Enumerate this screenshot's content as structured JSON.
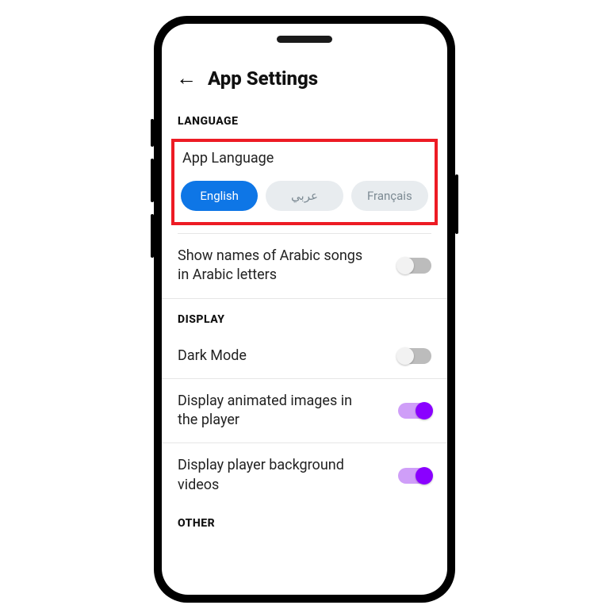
{
  "header": {
    "title": "App Settings"
  },
  "sections": {
    "language": {
      "header": "LANGUAGE",
      "appLanguageLabel": "App Language",
      "options": {
        "english": "English",
        "arabic": "عربي",
        "francais": "Français"
      },
      "arabicNamesLabel": "Show names of Arabic songs in Arabic letters",
      "arabicNamesOn": false
    },
    "display": {
      "header": "DISPLAY",
      "darkModeLabel": "Dark Mode",
      "darkModeOn": false,
      "animatedLabel": "Display animated images in the player",
      "animatedOn": true,
      "bgVideoLabel": "Display player background videos",
      "bgVideoOn": true
    },
    "other": {
      "header": "OTHER"
    }
  }
}
